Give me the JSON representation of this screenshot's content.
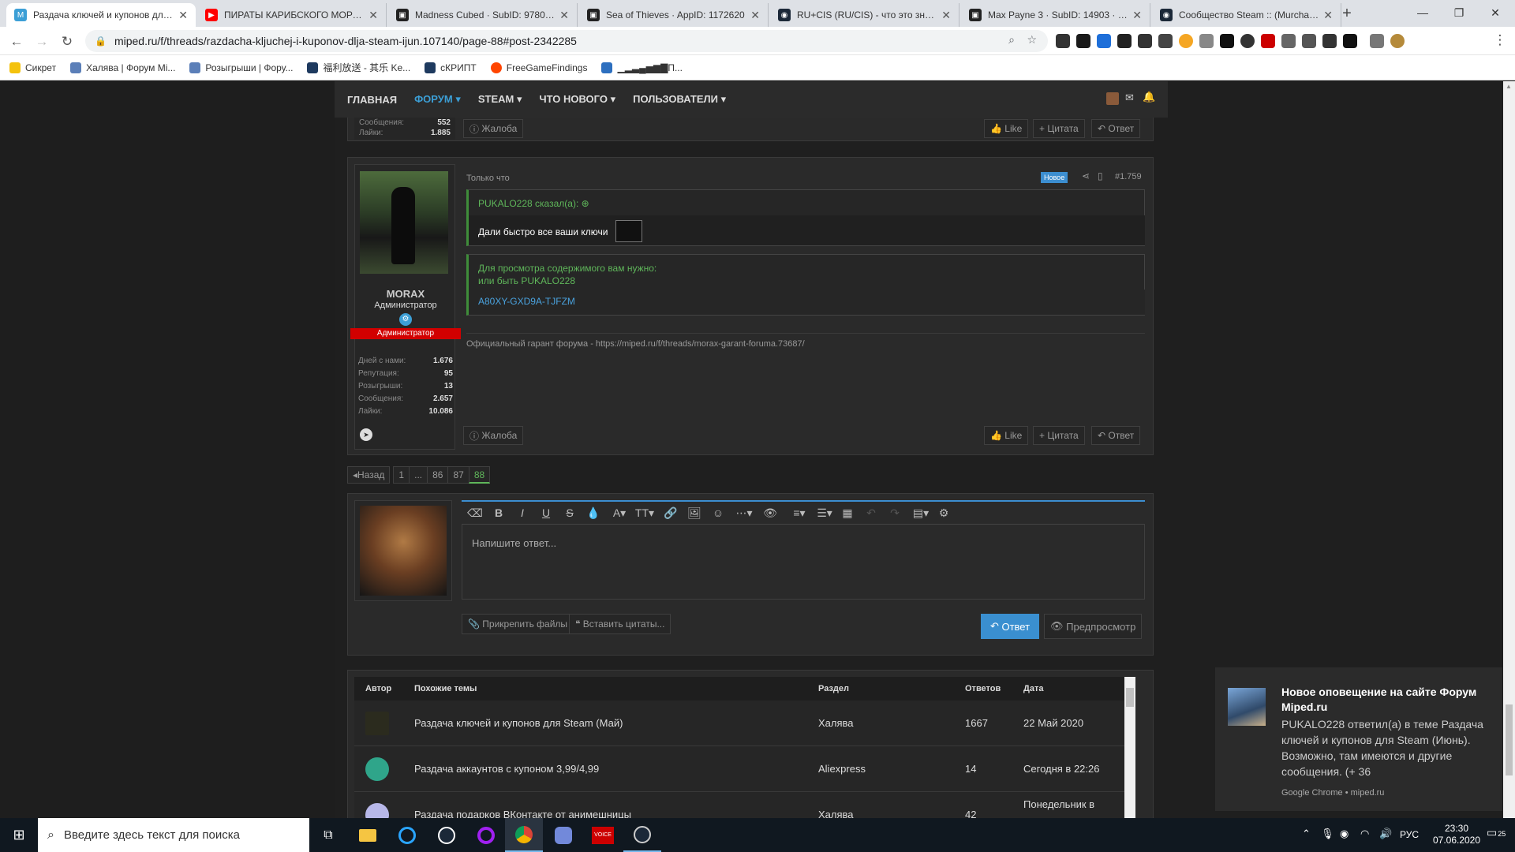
{
  "browser": {
    "tabs": [
      {
        "title": "Раздача ключей и купонов для Steam",
        "color": "#3c9fd6",
        "glyph": "M"
      },
      {
        "title": "ПИРАТЫ КАРИБСКОГО МОРЯ: На",
        "color": "#ff0000",
        "glyph": "▶"
      },
      {
        "title": "Madness Cubed · SubID: 97806 · S",
        "color": "#222222",
        "glyph": "▣"
      },
      {
        "title": "Sea of Thieves · AppID: 1172620",
        "color": "#222222",
        "glyph": "▣"
      },
      {
        "title": "RU+CIS (RU/CIS) - что это значит",
        "color": "#1b2838",
        "glyph": "◉"
      },
      {
        "title": "Max Payne 3 · SubID: 14903 · Stea",
        "color": "#222222",
        "glyph": "▣"
      },
      {
        "title": "Сообщество Steam :: (Murchand",
        "color": "#1b2838",
        "glyph": "◉"
      }
    ],
    "tab_close": "✕",
    "new_tab": "+",
    "url": "miped.ru/f/threads/razdacha-kljuchej-i-kuponov-dlja-steam-ijun.107140/page-88#post-2342285",
    "bookmarks": [
      "Сикрет",
      "Халява | Форум Mi...",
      "Розыгрыши | Фору...",
      "福利放送 - 其乐 Ke...",
      "сКРИПТ",
      "FreeGameFindings",
      "▁▂▃▄▅▆▇П..."
    ]
  },
  "forum": {
    "nav": [
      "ГЛАВНАЯ",
      "ФОРУМ",
      "STEAM",
      "ЧТО НОВОГО",
      "ПОЛЬЗОВАТЕЛИ"
    ],
    "prev_post": {
      "stat_label_1": "Сообщения:",
      "stat_value_1": "552",
      "stat_label_2": "Лайки:",
      "stat_value_2": "1.885",
      "report": "Жалоба",
      "like": "Like",
      "quote": "Цитата",
      "reply": "Ответ"
    },
    "post": {
      "time": "Только что",
      "badge_new": "Новое",
      "number": "#1.759",
      "author": "MORAX",
      "title": "Администратор",
      "banner": "Администратор",
      "stats": [
        {
          "label": "Дней с нами:",
          "value": "1.676"
        },
        {
          "label": "Репутация:",
          "value": "95"
        },
        {
          "label": "Розыгрыши:",
          "value": "13"
        },
        {
          "label": "Сообщения:",
          "value": "2.657"
        },
        {
          "label": "Лайки:",
          "value": "10.086"
        }
      ],
      "quote_author": "PUKALO228 сказал(а):",
      "quote_text": "Дали быстро все ваши ключи",
      "hidden_line1": "Для просмотра содержимого вам нужно:",
      "hidden_line2": "или быть PUKALO228",
      "key": "A80XY-GXD9A-TJFZM",
      "signature": "Официальный гарант форума - https://miped.ru/f/threads/morax-garant-foruma.73687/",
      "report": "Жалоба",
      "like": "Like",
      "quote": "Цитата",
      "reply": "Ответ"
    },
    "pagination": {
      "back": "Назад",
      "pages": [
        "1",
        "...",
        "86",
        "87",
        "88"
      ]
    },
    "editor": {
      "placeholder": "Напишите ответ...",
      "attach": "Прикрепить файлы",
      "insert_quotes": "Вставить цитаты...",
      "submit": "Ответ",
      "preview": "Предпросмотр"
    },
    "similar": {
      "headers": [
        "Автор",
        "Похожие темы",
        "Раздел",
        "Ответов",
        "Дата"
      ],
      "rows": [
        {
          "title": "Раздача ключей и купонов для Steam (Май)",
          "section": "Халява",
          "replies": "1667",
          "date": "22 Май 2020"
        },
        {
          "title": "Раздача аккаунтов с купоном 3,99/4,99",
          "section": "Aliexpress",
          "replies": "14",
          "date": "Сегодня в 22:26"
        },
        {
          "title": "Раздача подарков ВКонтакте от анимешницы",
          "section": "Халява",
          "replies": "42",
          "date": "Понедельник в"
        }
      ]
    }
  },
  "notification": {
    "title": "Новое оповещение на сайте Форум Miped.ru",
    "body": "PUKALO228 ответил(а) в теме Раздача ключей и купонов для Steam (Июнь). Возможно, там имеются и другие сообщения. (+ 36",
    "source": "Google Chrome • miped.ru"
  },
  "taskbar": {
    "search_placeholder": "Введите здесь текст для поиска",
    "language": "РУС",
    "time": "23:30",
    "date": "07.06.2020",
    "notif_count": "25"
  }
}
